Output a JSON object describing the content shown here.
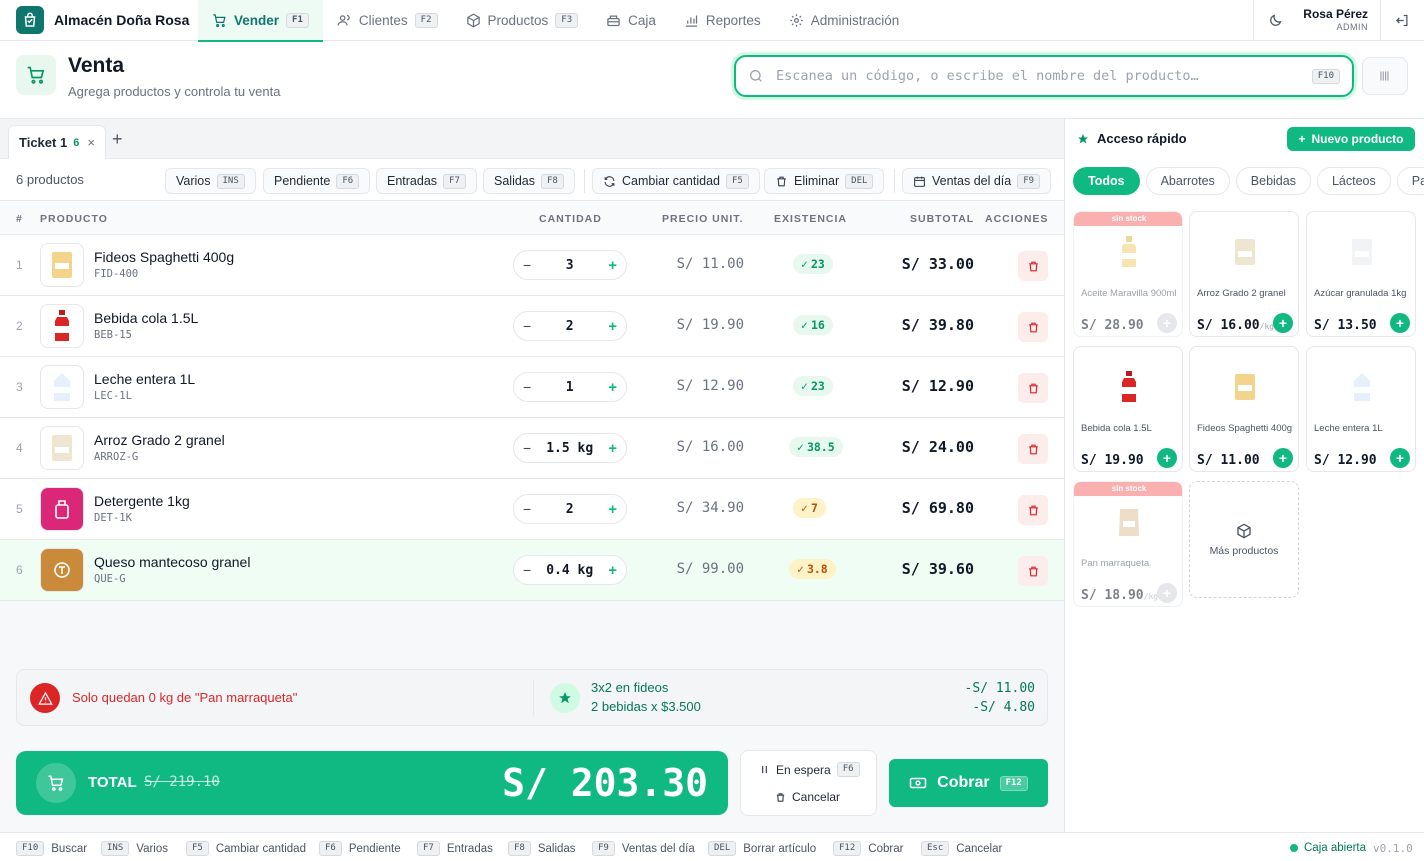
{
  "app": {
    "name": "Almacén Doña Rosa"
  },
  "nav": [
    {
      "label": "Vender",
      "key": "F1"
    },
    {
      "label": "Clientes",
      "key": "F2"
    },
    {
      "label": "Productos",
      "key": "F3"
    },
    {
      "label": "Caja",
      "key": ""
    },
    {
      "label": "Reportes",
      "key": ""
    },
    {
      "label": "Administración",
      "key": ""
    }
  ],
  "user": {
    "name": "Rosa Pérez",
    "role": "ADMIN"
  },
  "header": {
    "title": "Venta",
    "subtitle": "Agrega productos y controla tu venta"
  },
  "search": {
    "placeholder": "Escanea un código, o escribe el nombre del producto…",
    "key": "F10"
  },
  "ticket": {
    "label": "Ticket 1",
    "count": "6"
  },
  "toolbar": {
    "count_text": "6 productos",
    "varios": {
      "label": "Varios",
      "key": "INS"
    },
    "pendiente": {
      "label": "Pendiente",
      "key": "F6"
    },
    "entradas": {
      "label": "Entradas",
      "key": "F7"
    },
    "salidas": {
      "label": "Salidas",
      "key": "F8"
    },
    "cambiar": {
      "label": "Cambiar cantidad",
      "key": "F5"
    },
    "eliminar": {
      "label": "Eliminar",
      "key": "DEL"
    },
    "ventas": {
      "label": "Ventas del día",
      "key": "F9"
    }
  },
  "columns": {
    "num": "#",
    "product": "PRODUCTO",
    "qty": "CANTIDAD",
    "price": "PRECIO UNIT.",
    "stock": "EXISTENCIA",
    "subtotal": "SUBTOTAL",
    "actions": "ACCIONES"
  },
  "items": [
    {
      "n": "1",
      "name": "Fideos Spaghetti 400g",
      "code": "FID-400",
      "qty": "3",
      "price": "S/ 11.00",
      "stock": "23",
      "stock_level": "ok",
      "subtotal": "S/ 33.00",
      "icon": "pasta-bag-icon"
    },
    {
      "n": "2",
      "name": "Bebida cola 1.5L",
      "code": "BEB-15",
      "qty": "2",
      "price": "S/ 19.90",
      "stock": "16",
      "stock_level": "ok",
      "subtotal": "S/ 39.80",
      "icon": "soda-bottle-icon"
    },
    {
      "n": "3",
      "name": "Leche entera 1L",
      "code": "LEC-1L",
      "qty": "1",
      "price": "S/ 12.90",
      "stock": "23",
      "stock_level": "ok",
      "subtotal": "S/ 12.90",
      "icon": "milk-carton-icon"
    },
    {
      "n": "4",
      "name": "Arroz Grado 2 granel",
      "code": "ARROZ-G",
      "qty": "1.5 kg",
      "price": "S/ 16.00",
      "stock": "38.5",
      "stock_level": "ok",
      "subtotal": "S/ 24.00",
      "icon": "rice-bag-icon"
    },
    {
      "n": "5",
      "name": "Detergente 1kg",
      "code": "DET-1K",
      "qty": "2",
      "price": "S/ 34.90",
      "stock": "7",
      "stock_level": "low",
      "subtotal": "S/ 69.80",
      "icon": "detergent-icon"
    },
    {
      "n": "6",
      "name": "Queso mantecoso granel",
      "code": "QUE-G",
      "qty": "0.4 kg",
      "price": "S/ 99.00",
      "stock": "3.8",
      "stock_level": "low",
      "subtotal": "S/ 39.60",
      "icon": "cheese-icon"
    }
  ],
  "alerts": {
    "warning": "Solo quedan 0 kg de \"Pan marraqueta\"",
    "promos": [
      {
        "label": "3x2 en fideos",
        "amount": "-S/ 11.00"
      },
      {
        "label": "2 bebidas x $3.500",
        "amount": "-S/ 4.80"
      }
    ]
  },
  "totals": {
    "label": "TOTAL",
    "old": "S/ 219.10",
    "value": "S/ 203.30"
  },
  "hold": {
    "label": "En espera",
    "key": "F6",
    "cancel": "Cancelar"
  },
  "pay": {
    "label": "Cobrar",
    "key": "F12"
  },
  "quick": {
    "title": "Acceso rápido",
    "new_product": "Nuevo producto",
    "categories": [
      "Todos",
      "Abarrotes",
      "Bebidas",
      "Lácteos",
      "Panadería"
    ],
    "no_stock": "sin stock",
    "cards": [
      {
        "name": "Aceite Maravilla 900ml",
        "price": "S/ 28.90",
        "unit": "",
        "no_stock": true,
        "icon": "oil-bottle-icon"
      },
      {
        "name": "Arroz Grado 2 granel",
        "price": "S/ 16.00",
        "unit": "/kg",
        "no_stock": false,
        "icon": "rice-bag-icon"
      },
      {
        "name": "Azúcar granulada 1kg",
        "price": "S/ 13.50",
        "unit": "",
        "no_stock": false,
        "icon": "sugar-bag-icon"
      },
      {
        "name": "Bebida cola 1.5L",
        "price": "S/ 19.90",
        "unit": "",
        "no_stock": false,
        "icon": "soda-bottle-icon"
      },
      {
        "name": "Fideos Spaghetti 400g",
        "price": "S/ 11.00",
        "unit": "",
        "no_stock": false,
        "icon": "pasta-bag-icon"
      },
      {
        "name": "Leche entera 1L",
        "price": "S/ 12.90",
        "unit": "",
        "no_stock": false,
        "icon": "milk-carton-icon"
      },
      {
        "name": "Pan marraqueta",
        "price": "S/ 18.90",
        "unit": "/kg",
        "no_stock": true,
        "icon": "bread-bag-icon"
      }
    ],
    "more": "Más productos"
  },
  "footer": {
    "shortcuts": [
      {
        "key": "F10",
        "label": "Buscar"
      },
      {
        "key": "INS",
        "label": "Varios"
      },
      {
        "key": "F5",
        "label": "Cambiar cantidad"
      },
      {
        "key": "F6",
        "label": "Pendiente"
      },
      {
        "key": "F7",
        "label": "Entradas"
      },
      {
        "key": "F8",
        "label": "Salidas"
      },
      {
        "key": "F9",
        "label": "Ventas del día"
      },
      {
        "key": "DEL",
        "label": "Borrar artículo"
      },
      {
        "key": "F12",
        "label": "Cobrar"
      },
      {
        "key": "Esc",
        "label": "Cancelar"
      }
    ],
    "status": "Caja abierta",
    "version": "v0.1.0"
  },
  "colors": {
    "accent": "#10b981",
    "accent_dark": "#0f766e",
    "danger": "#dc2626",
    "warning": "#b45309"
  }
}
